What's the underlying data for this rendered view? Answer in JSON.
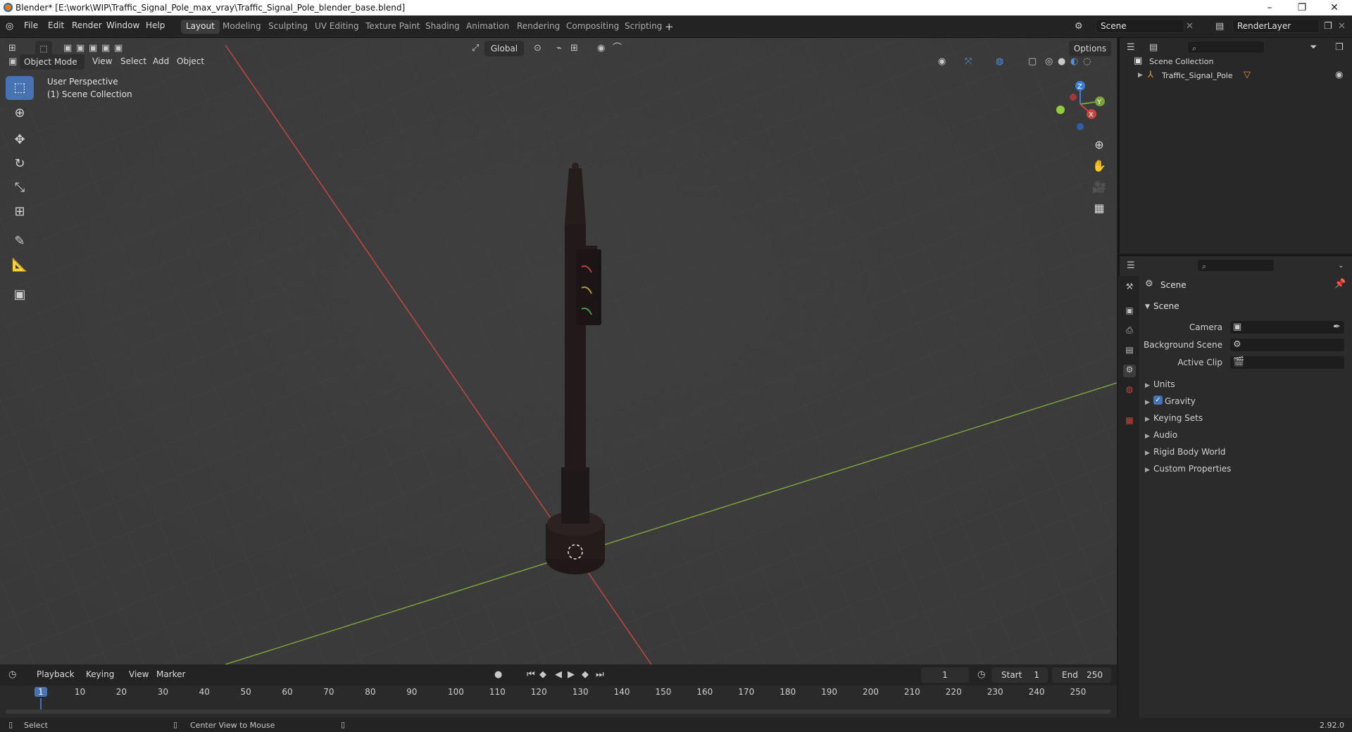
{
  "title_bar": {
    "title": "Blender* [E:\\work\\WIP\\Traffic_Signal_Pole_max_vray\\Traffic_Signal_Pole_blender_base.blend]",
    "controls": [
      "–",
      "❐",
      "✕"
    ]
  },
  "menus": [
    "File",
    "Edit",
    "Render",
    "Window",
    "Help"
  ],
  "workspaces": [
    "Layout",
    "Modeling",
    "Sculpting",
    "UV Editing",
    "Texture Paint",
    "Shading",
    "Animation",
    "Rendering",
    "Compositing",
    "Scripting"
  ],
  "active_workspace": "Layout",
  "scene_selector": "Scene",
  "render_layer": "RenderLayer",
  "viewport_header": {
    "mode": "Object Mode",
    "menus": [
      "View",
      "Select",
      "Add",
      "Object"
    ],
    "transform_orientation": "Global",
    "options_label": "Options"
  },
  "viewport_overlay": {
    "line1": "User Perspective",
    "line2": "(1) Scene Collection"
  },
  "gizmo": {
    "x": "X",
    "y": "Y",
    "z": "Z"
  },
  "outliner": {
    "root": "Scene Collection",
    "items": [
      {
        "name": "Traffic_Signal_Pole"
      }
    ]
  },
  "properties": {
    "context_title": "Scene",
    "panel_title": "Scene",
    "fields": [
      {
        "label": "Camera"
      },
      {
        "label": "Background Scene"
      },
      {
        "label": "Active Clip"
      }
    ],
    "collapsed_panels": [
      "Units",
      "Gravity",
      "Keying Sets",
      "Audio",
      "Rigid Body World",
      "Custom Properties"
    ],
    "gravity_checked": true
  },
  "timeline": {
    "menus": [
      "Playback",
      "Keying",
      "View",
      "Marker"
    ],
    "current_frame": "1",
    "start_label": "Start",
    "start_value": "1",
    "end_label": "End",
    "end_value": "250",
    "ticks": [
      "1",
      "10",
      "20",
      "30",
      "40",
      "50",
      "60",
      "70",
      "80",
      "90",
      "100",
      "110",
      "120",
      "130",
      "140",
      "150",
      "160",
      "170",
      "180",
      "190",
      "200",
      "210",
      "220",
      "230",
      "240",
      "250"
    ]
  },
  "status_bar": {
    "left": "Select",
    "middle": "Center View to Mouse",
    "version": "2.92.0"
  },
  "colors": {
    "accent": "#4772b3",
    "x_axis": "#c8453f",
    "y_axis": "#7aa13a",
    "z_axis": "#3a7cd6",
    "viewport_bg": "#3d3d3d"
  }
}
